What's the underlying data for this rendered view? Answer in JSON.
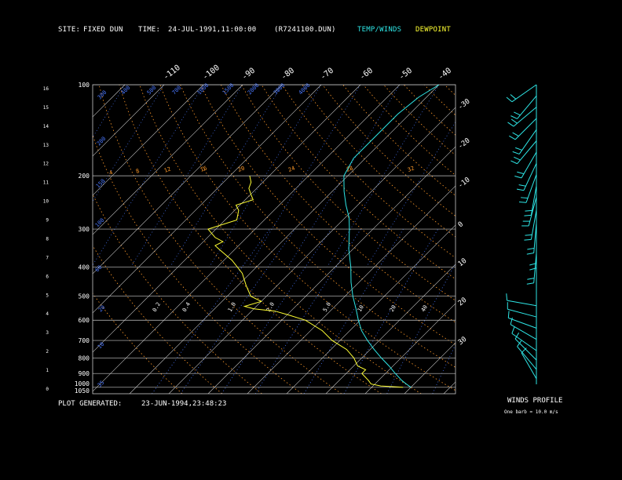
{
  "header": {
    "site_label": "SITE:",
    "site_value": "FIXED DUN",
    "time_label": "TIME:",
    "time_value": "24-JUL-1991,11:00:00",
    "file_name": "(R7241100.DUN)",
    "temp_winds_legend": "TEMP/WINDS",
    "dewpoint_legend": "DEWPOINT"
  },
  "footer": {
    "plot_generated_label": "PLOT GENERATED:",
    "plot_generated_value": "23-JUN-1994,23:48:23",
    "winds_profile_title": "WINDS PROFILE",
    "barb_note": "One barb = 10.0 m/s"
  },
  "colors": {
    "background": "#000000",
    "temperature": "#2ee6e6",
    "dewpoint": "#ffff33",
    "grid": "#c8c8c8",
    "mixing_ratio": "#4a78ff",
    "dry_adiabat": "#ff9a2a",
    "text": "#ffffff"
  },
  "chart_data": {
    "type": "line",
    "diagram": "skew-T log-P",
    "pressure_levels_hpa": [
      100,
      200,
      300,
      400,
      500,
      600,
      700,
      800,
      900,
      1000
    ],
    "pressure_tick_labels": [
      "100",
      "200",
      "300",
      "400",
      "500",
      "600",
      "700",
      "800",
      "900",
      "1000",
      "1050"
    ],
    "height_km_ticks": [
      0,
      1,
      2,
      3,
      4,
      5,
      6,
      7,
      8,
      9,
      10,
      11,
      12,
      13,
      14,
      15,
      16
    ],
    "top_isotherm_labels": [
      "-110",
      "-100",
      "-90",
      "-80",
      "-70",
      "-60",
      "-50",
      "-40"
    ],
    "right_isotherm_labels": [
      "-30",
      "-20",
      "-10",
      "0",
      "10",
      "20",
      "30"
    ],
    "mixing_ratio_labels": [
      "35",
      "10",
      "20",
      "60",
      "100",
      "150",
      "200",
      "300",
      "400",
      "500",
      "700",
      "1000",
      "1500",
      "2000",
      "3000",
      "4000"
    ],
    "lower_mixing_ratio_labels": [
      "0.2",
      "0.4",
      "1.0",
      "2.0",
      "5.0",
      "10",
      "20",
      "40"
    ],
    "adiabat_labels": [
      "4",
      "8",
      "12",
      "16",
      "20",
      "24",
      "28",
      "32"
    ],
    "series": [
      {
        "name": "TEMP/WINDS",
        "points": [
          [
            1000,
            30
          ],
          [
            975,
            28
          ],
          [
            950,
            26
          ],
          [
            900,
            22.5
          ],
          [
            850,
            19
          ],
          [
            800,
            15
          ],
          [
            750,
            11
          ],
          [
            700,
            7
          ],
          [
            650,
            3
          ],
          [
            600,
            -0.5
          ],
          [
            550,
            -4
          ],
          [
            500,
            -8
          ],
          [
            450,
            -12
          ],
          [
            400,
            -16
          ],
          [
            350,
            -21
          ],
          [
            300,
            -26
          ],
          [
            275,
            -29
          ],
          [
            250,
            -33
          ],
          [
            225,
            -37
          ],
          [
            200,
            -41
          ],
          [
            175,
            -43
          ],
          [
            150,
            -43
          ],
          [
            125,
            -43
          ],
          [
            110,
            -42
          ],
          [
            100,
            -40
          ]
        ]
      },
      {
        "name": "DEWPOINT",
        "points": [
          [
            1000,
            28
          ],
          [
            990,
            22
          ],
          [
            975,
            19
          ],
          [
            950,
            17.5
          ],
          [
            900,
            14
          ],
          [
            875,
            14
          ],
          [
            850,
            11
          ],
          [
            800,
            8
          ],
          [
            750,
            4
          ],
          [
            700,
            -2
          ],
          [
            650,
            -7
          ],
          [
            600,
            -14
          ],
          [
            575,
            -20
          ],
          [
            560,
            -24
          ],
          [
            550,
            -30
          ],
          [
            540,
            -33
          ],
          [
            520,
            -30
          ],
          [
            500,
            -34
          ],
          [
            460,
            -38
          ],
          [
            420,
            -42
          ],
          [
            380,
            -48
          ],
          [
            350,
            -54
          ],
          [
            340,
            -56
          ],
          [
            330,
            -55
          ],
          [
            320,
            -58
          ],
          [
            300,
            -62
          ],
          [
            280,
            -57
          ],
          [
            260,
            -59
          ],
          [
            250,
            -61
          ],
          [
            240,
            -58
          ],
          [
            230,
            -60
          ],
          [
            220,
            -62
          ],
          [
            210,
            -63
          ],
          [
            200,
            -65
          ]
        ]
      }
    ],
    "winds_profile": {
      "height_km_range": [
        0,
        16
      ],
      "barb_speed_unit_ms": 10.0,
      "levels": [
        {
          "height_km": 0.3,
          "dir_deg": 330,
          "speed_ms": 8
        },
        {
          "height_km": 0.8,
          "dir_deg": 320,
          "speed_ms": 12
        },
        {
          "height_km": 1.3,
          "dir_deg": 315,
          "speed_ms": 12
        },
        {
          "height_km": 1.8,
          "dir_deg": 305,
          "speed_ms": 10
        },
        {
          "height_km": 2.4,
          "dir_deg": 300,
          "speed_ms": 12
        },
        {
          "height_km": 3.0,
          "dir_deg": 290,
          "speed_ms": 10
        },
        {
          "height_km": 3.6,
          "dir_deg": 285,
          "speed_ms": 8
        },
        {
          "height_km": 4.2,
          "dir_deg": 280,
          "speed_ms": 10
        },
        {
          "height_km": 7.0,
          "dir_deg": 185,
          "speed_ms": 20
        },
        {
          "height_km": 7.8,
          "dir_deg": 180,
          "speed_ms": 20
        },
        {
          "height_km": 8.6,
          "dir_deg": 185,
          "speed_ms": 20
        },
        {
          "height_km": 9.3,
          "dir_deg": 190,
          "speed_ms": 20
        },
        {
          "height_km": 10.0,
          "dir_deg": 195,
          "speed_ms": 20
        },
        {
          "height_km": 10.6,
          "dir_deg": 190,
          "speed_ms": 22
        },
        {
          "height_km": 11.2,
          "dir_deg": 200,
          "speed_ms": 22
        },
        {
          "height_km": 11.8,
          "dir_deg": 205,
          "speed_ms": 22
        },
        {
          "height_km": 12.4,
          "dir_deg": 210,
          "speed_ms": 24
        },
        {
          "height_km": 13.0,
          "dir_deg": 220,
          "speed_ms": 20
        },
        {
          "height_km": 13.6,
          "dir_deg": 215,
          "speed_ms": 22
        },
        {
          "height_km": 14.2,
          "dir_deg": 225,
          "speed_ms": 20
        },
        {
          "height_km": 14.8,
          "dir_deg": 230,
          "speed_ms": 20
        },
        {
          "height_km": 15.4,
          "dir_deg": 220,
          "speed_ms": 24
        },
        {
          "height_km": 16.0,
          "dir_deg": 235,
          "speed_ms": 22
        }
      ]
    }
  }
}
